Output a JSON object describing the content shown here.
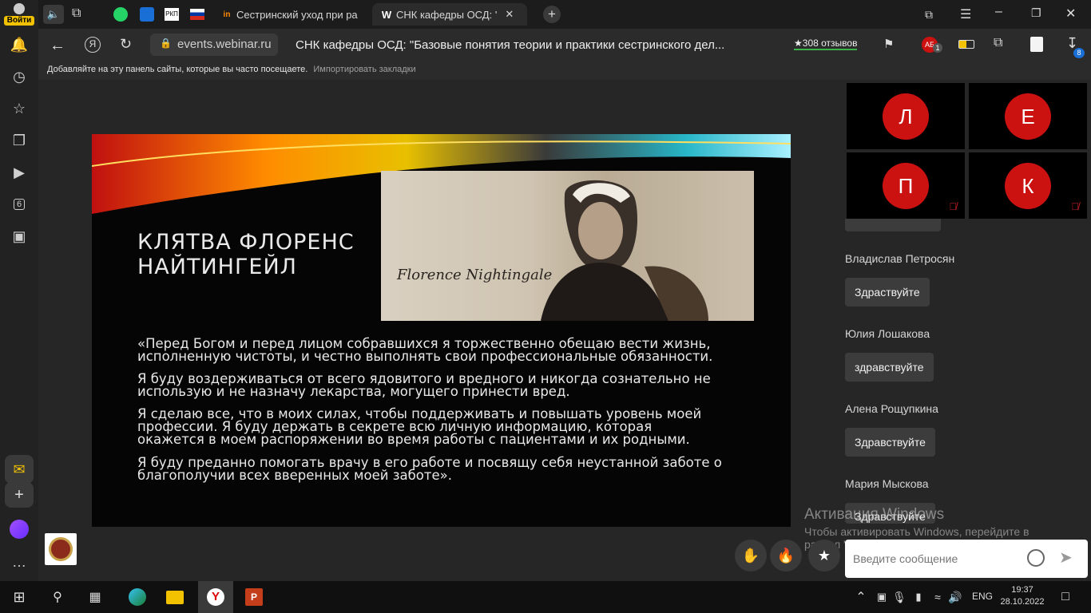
{
  "browser": {
    "login_label": "Войти",
    "tabs": [
      {
        "label": "Сестринский уход при ра",
        "favicon": "webinar-favicon"
      },
      {
        "label": "СНК кафедры ОСД: '",
        "favicon": "W"
      }
    ],
    "address_domain": "events.webinar.ru",
    "page_title": "СНК кафедры ОСД: \"Базовые понятия теории и практики сестринского дел...",
    "reviews": "308 отзывов",
    "notif_badge": "1",
    "download_badge": "8",
    "bookmarks_hint": "Добавляйте на эту панель сайты, которые вы часто посещаете.",
    "import_bookmarks": "Импортировать закладки",
    "rail_tab_count": "6"
  },
  "slide": {
    "title_line1": "КЛЯТВА ФЛОРЕНС",
    "title_line2": "НАЙТИНГЕЙЛ",
    "signature": "Florence Nightingale",
    "paragraphs": [
      [
        "«Перед Богом и перед лицом собравшихся я торжественно обещаю вести жизнь,",
        "исполненную чистоты, и честно выполнять свои профессиональные обязанности."
      ],
      [
        "Я буду воздерживаться от всего ядовитого и вредного и никогда сознательно не",
        "использую и не назначу лекарства, могущего принести вред."
      ],
      [
        "Я сделаю все, что в моих силах, чтобы поддерживать и повышать уровень моей",
        "профессии. Я буду держать в секрете всю личную информацию, которая",
        "окажется в моем распоряжении во время работы с пациентами и их родными."
      ],
      [
        "Я буду преданно помогать врачу в его работе и посвящу себя неустанной заботе о",
        "благополучии всех вверенных моей заботе»."
      ]
    ]
  },
  "participants": [
    {
      "initial": "Л",
      "muted": false
    },
    {
      "initial": "Е",
      "muted": false
    },
    {
      "initial": "П",
      "muted": true
    },
    {
      "initial": "К",
      "muted": true
    }
  ],
  "chat": {
    "messages": [
      {
        "author": "Владислав Петросян",
        "text": "Здраствуйте"
      },
      {
        "author": "Юлия Лошакова",
        "text": "здравствуйте"
      },
      {
        "author": "Алена Рощупкина",
        "text": "Здравствуйте"
      },
      {
        "author": "Мария Мыскова",
        "text": "Здравствуйте"
      }
    ],
    "input_placeholder": "Введите сообщение"
  },
  "watermark": {
    "line1": "Активация Windows",
    "line2": "Чтобы активировать Windows, перейдите в",
    "line3": "раздел \"Параметры\"."
  },
  "taskbar": {
    "lang": "ENG",
    "time": "19:37",
    "date": "28.10.2022"
  },
  "colors": {
    "accent_red": "#cc1111",
    "yandex_yellow": "#ffcc00"
  }
}
